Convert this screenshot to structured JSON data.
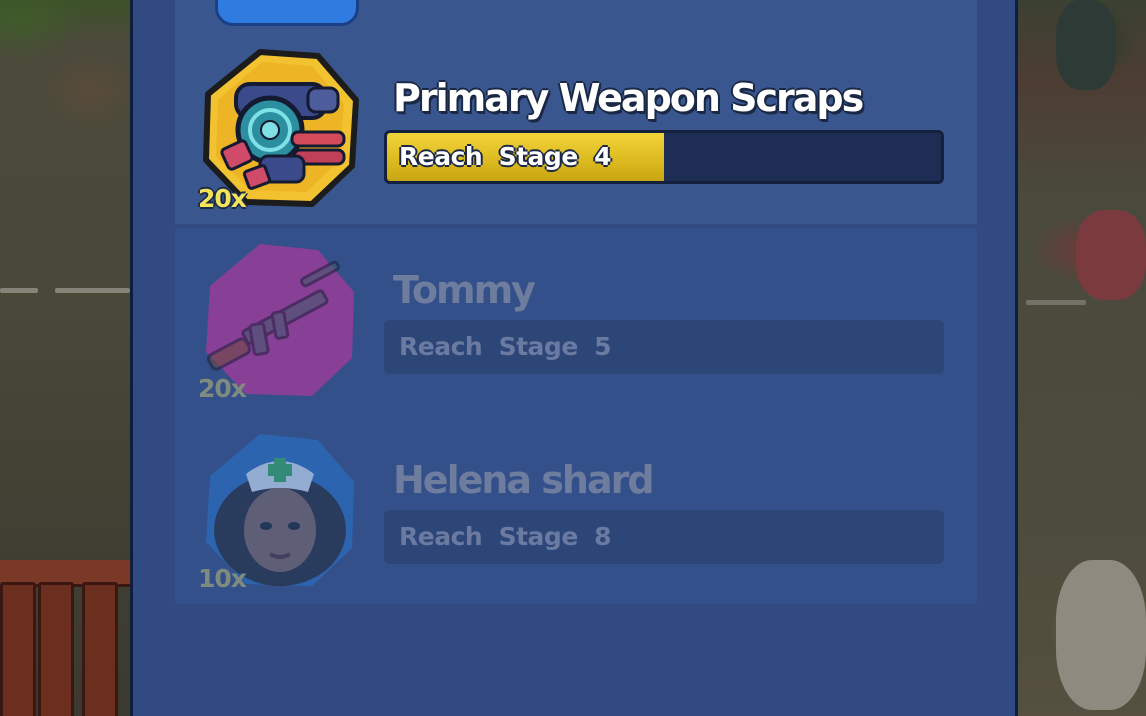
{
  "rewards": [
    {
      "title": "Primary Weapon Scraps",
      "quantity": "20x",
      "requirement": "Reach  Stage  4",
      "progress_fraction": 0.5,
      "icon": "weapon-scraps-icon",
      "state": "active",
      "badge_color": "#f2c230"
    },
    {
      "title": "Tommy",
      "quantity": "20x",
      "requirement": "Reach  Stage  5",
      "progress_fraction": 0,
      "icon": "tommy-gun-icon",
      "state": "locked",
      "badge_color": "#a43a9a"
    },
    {
      "title": "Helena shard",
      "quantity": "10x",
      "requirement": "Reach  Stage  8",
      "progress_fraction": 0,
      "icon": "helena-portrait-icon",
      "state": "locked",
      "badge_color": "#2a6cc0"
    }
  ],
  "colors": {
    "panel": "#314a81",
    "progress_fill": "#f1d43a",
    "quantity_text": "#f2e35a"
  }
}
